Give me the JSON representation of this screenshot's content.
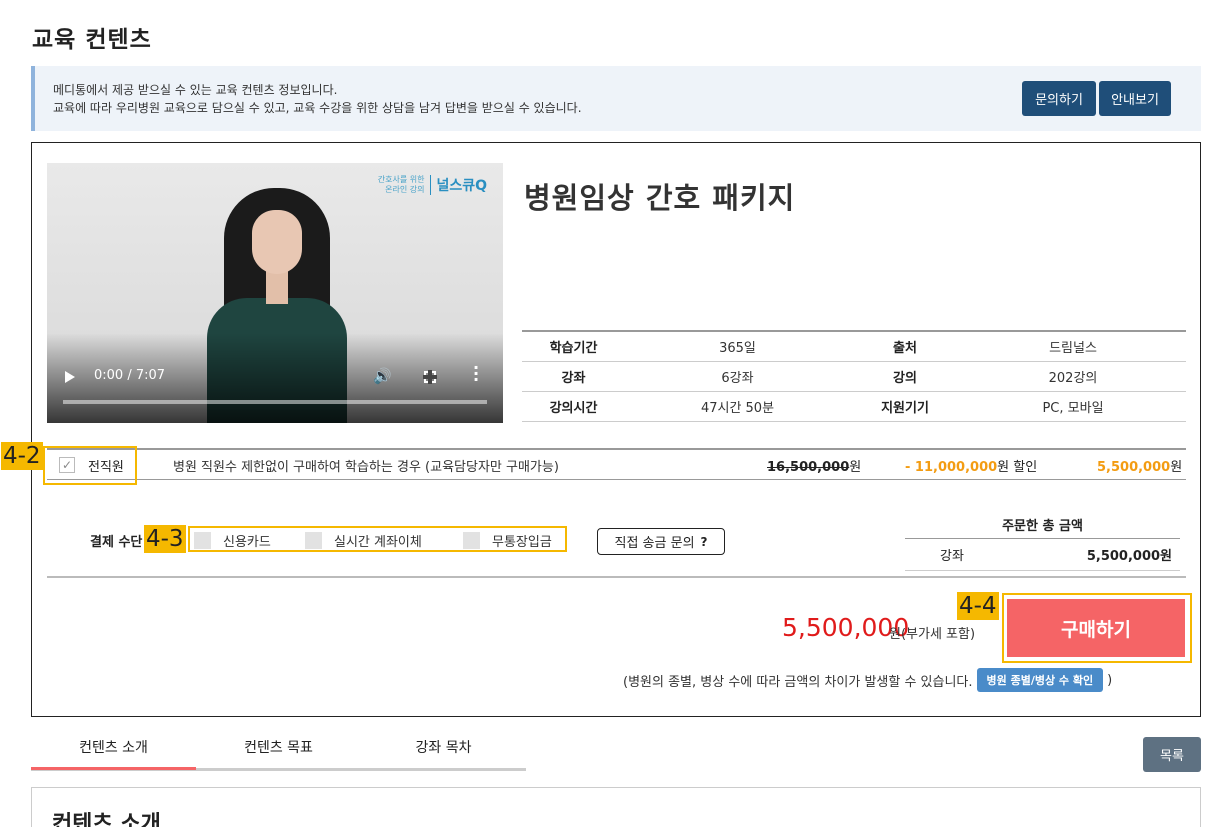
{
  "page": {
    "title": "교육 컨텐츠"
  },
  "info": {
    "line1": "메디통에서 제공 받으실 수 있는 교육 컨텐츠 정보입니다.",
    "line2": "교육에 따라 우리병원 교육으로 담으실 수 있고, 교육 수강을 위한 상담을 남겨 답변을 받으실 수 있습니다.",
    "inquiry_label": "문의하기",
    "guide_label": "안내보기"
  },
  "video": {
    "logo_sub1": "간호사를 위한",
    "logo_sub2": "온라인 강의",
    "logo_main": "널스큐Q",
    "time": "0:00 / 7:07",
    "progress": 0
  },
  "product": {
    "title": "병원임상 간호 패키지",
    "specs": [
      {
        "label1": "학습기간",
        "value1": "365일",
        "label2": "출처",
        "value2": "드림널스"
      },
      {
        "label1": "강좌",
        "value1": "6강좌",
        "label2": "강의",
        "value2": "202강의"
      },
      {
        "label1": "강의시간",
        "value1": "47시간 50분",
        "label2": "지원기기",
        "value2": "PC, 모바일"
      }
    ]
  },
  "option": {
    "name": "전직원",
    "checked": true,
    "desc": "병원 직원수 제한없이 구매하여 학습하는 경우 (교육담당자만 구매가능)",
    "orig_price": "16,500,000",
    "orig_unit": "원",
    "discount": "- 11,000,000",
    "discount_unit": "원 할인",
    "final_price": "5,500,000",
    "final_unit": "원"
  },
  "payment": {
    "label": "결제 수단",
    "options": [
      "신용카드",
      "실시간 계좌이체",
      "무통장입금"
    ],
    "direct_label": "직접 송금 문의",
    "direct_icon": "?"
  },
  "total": {
    "title": "주문한 총 금액",
    "row_label": "강좌",
    "row_value": "5,500,000원"
  },
  "purchase": {
    "grand_price": "5,500,000",
    "vat_note": "원(부가세 포함)",
    "buy_label": "구매하기",
    "diff_note": "(병원의 종별, 병상 수에 따라 금액의 차이가 발생할 수 있습니다.",
    "check_label": "병원 종별/병상 수 확인",
    "close_paren": ")"
  },
  "tabs": [
    "컨텐츠 소개",
    "컨텐츠 목표",
    "강좌 목차"
  ],
  "list_label": "목록",
  "intro_title": "컨텐츠 소개",
  "annotations": [
    "4-2",
    "4-3",
    "4-4"
  ],
  "colors": {
    "primary": "#1f4e79",
    "buy": "#f56466",
    "highlight": "#f5b800",
    "price_red": "#e01b1b",
    "accent_orange": "#f39c12"
  }
}
